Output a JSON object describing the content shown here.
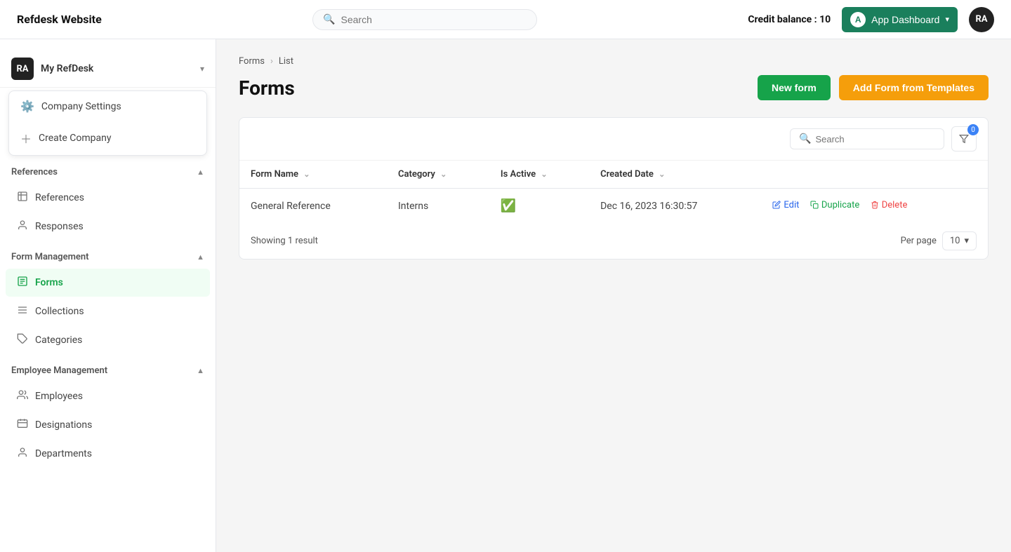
{
  "app": {
    "logo": "Refdesk Website",
    "search_placeholder": "Search",
    "credit_label": "Credit balance :",
    "credit_value": "10",
    "dashboard_btn": "App Dashboard",
    "dashboard_avatar": "A",
    "user_initials": "RA"
  },
  "sidebar": {
    "user_initials": "RA",
    "user_name": "My RefDesk",
    "dropdown": {
      "items": [
        {
          "id": "company-settings",
          "icon": "⚙",
          "label": "Company Settings"
        },
        {
          "id": "create-company",
          "icon": "+",
          "label": "Create Company"
        }
      ]
    },
    "sections": [
      {
        "id": "references",
        "title": "References",
        "items": [
          {
            "id": "references",
            "icon": "📋",
            "label": "References"
          },
          {
            "id": "responses",
            "icon": "🗂",
            "label": "Responses"
          }
        ]
      },
      {
        "id": "form-management",
        "title": "Form Management",
        "items": [
          {
            "id": "forms",
            "icon": "📝",
            "label": "Forms",
            "active": true
          },
          {
            "id": "collections",
            "icon": "📁",
            "label": "Collections"
          },
          {
            "id": "categories",
            "icon": "🏷",
            "label": "Categories"
          }
        ]
      },
      {
        "id": "employee-management",
        "title": "Employee Management",
        "items": [
          {
            "id": "employees",
            "icon": "👥",
            "label": "Employees"
          },
          {
            "id": "designations",
            "icon": "🪪",
            "label": "Designations"
          },
          {
            "id": "departments",
            "icon": "👤",
            "label": "Departments"
          }
        ]
      }
    ]
  },
  "page": {
    "breadcrumb_root": "Forms",
    "breadcrumb_current": "List",
    "title": "Forms",
    "btn_new_form": "New form",
    "btn_add_template": "Add Form from Templates"
  },
  "table": {
    "search_placeholder": "Search",
    "filter_count": "0",
    "columns": [
      {
        "id": "form-name",
        "label": "Form Name"
      },
      {
        "id": "category",
        "label": "Category"
      },
      {
        "id": "is-active",
        "label": "Is Active"
      },
      {
        "id": "created-date",
        "label": "Created Date"
      }
    ],
    "rows": [
      {
        "form_name": "General Reference",
        "category": "Interns",
        "is_active": true,
        "created_date": "Dec 16, 2023 16:30:57"
      }
    ],
    "footer": {
      "showing_text": "Showing 1 result",
      "per_page_label": "Per page",
      "per_page_value": "10"
    },
    "actions": {
      "edit": "Edit",
      "duplicate": "Duplicate",
      "delete": "Delete"
    }
  }
}
